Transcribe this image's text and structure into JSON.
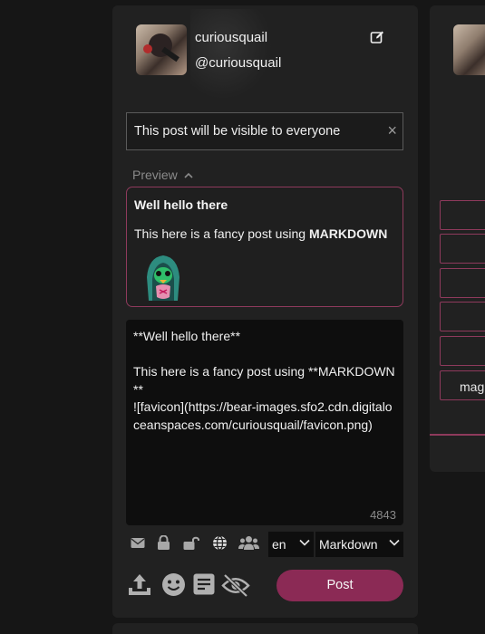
{
  "profile": {
    "username": "curiousquail",
    "handle": "@curiousquail",
    "edit_icon": "edit-icon"
  },
  "visibility": {
    "text": "This post will be visible to everyone",
    "close": "×"
  },
  "preview": {
    "toggle_label": "Preview",
    "chevron": "chevron-up-icon",
    "title": "Well hello there",
    "body_prefix": "This here is a fancy post using ",
    "body_bold": "MARKDOWN",
    "image": "favicon"
  },
  "editor": {
    "content": "**Well hello there**\n\nThis here is a fancy post using **MARKDOWN**\n![favicon](https://bear-images.sfo2.cdn.digitaloceanspaces.com/curiousquail/favicon.png)",
    "char_count": "4843"
  },
  "toolbar": {
    "icons": [
      "envelope-icon",
      "lock-icon",
      "unlock-icon",
      "globe-icon",
      "users-icon"
    ],
    "language": "en",
    "format": "Markdown",
    "bottom_icons": [
      "upload-icon",
      "emoji-icon",
      "post-list-icon",
      "eye-slash-icon"
    ]
  },
  "post_button": "Post",
  "side_panel": {
    "partial_label": "mag"
  },
  "colors": {
    "accent": "#8b2a55",
    "accent_border": "#8e3a5c",
    "panel": "#212121",
    "background": "#161616"
  }
}
